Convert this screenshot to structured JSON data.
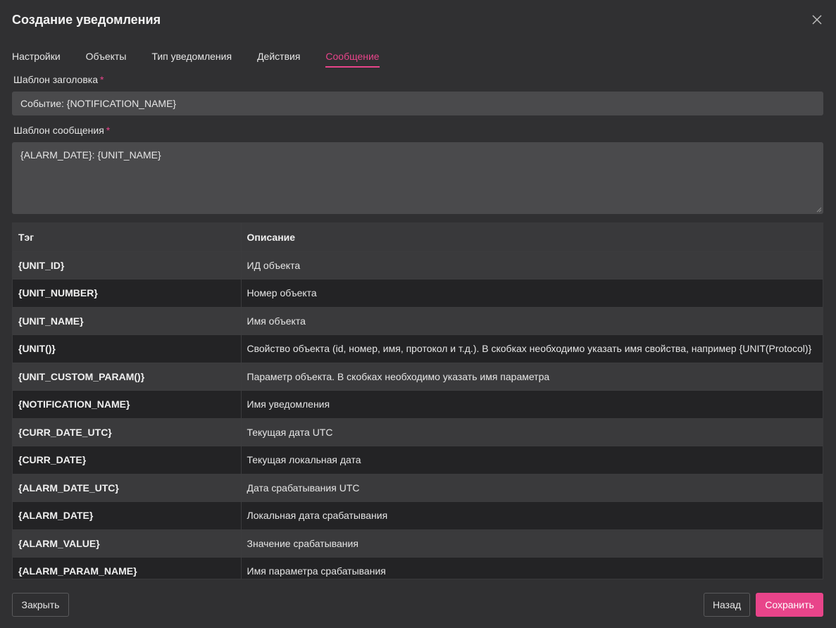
{
  "dialog": {
    "title": "Создание уведомления",
    "close_icon": "close-icon"
  },
  "tabs": [
    {
      "label": "Настройки",
      "active": false
    },
    {
      "label": "Объекты",
      "active": false
    },
    {
      "label": "Тип уведомления",
      "active": false
    },
    {
      "label": "Действия",
      "active": false
    },
    {
      "label": "Сообщение",
      "active": true
    }
  ],
  "form": {
    "header_template_label": "Шаблон заголовка",
    "header_template_value": "Событие: {NOTIFICATION_NAME}",
    "message_template_label": "Шаблон сообщения",
    "message_template_value": "{ALARM_DATE}: {UNIT_NAME}",
    "required_mark": "*"
  },
  "table": {
    "columns": [
      "Тэг",
      "Описание"
    ],
    "rows": [
      {
        "tag": "{UNIT_ID}",
        "desc": "ИД объекта"
      },
      {
        "tag": "{UNIT_NUMBER}",
        "desc": "Номер объекта"
      },
      {
        "tag": "{UNIT_NAME}",
        "desc": "Имя объекта"
      },
      {
        "tag": "{UNIT()}",
        "desc": "Свойство объекта (id, номер, имя, протокол и т.д.). В скобках необходимо указать имя свойства, например {UNIT(Protocol)}"
      },
      {
        "tag": "{UNIT_CUSTOM_PARAM()}",
        "desc": "Параметр объекта. В скобках необходимо указать имя параметра"
      },
      {
        "tag": "{NOTIFICATION_NAME}",
        "desc": "Имя уведомления"
      },
      {
        "tag": "{CURR_DATE_UTC}",
        "desc": "Текущая дата UTC"
      },
      {
        "tag": "{CURR_DATE}",
        "desc": "Текущая локальная дата"
      },
      {
        "tag": "{ALARM_DATE_UTC}",
        "desc": "Дата срабатывания UTC"
      },
      {
        "tag": "{ALARM_DATE}",
        "desc": "Локальная дата срабатывания"
      },
      {
        "tag": "{ALARM_VALUE}",
        "desc": "Значение срабатывания"
      },
      {
        "tag": "{ALARM_PARAM_NAME}",
        "desc": "Имя параметра срабатывания"
      }
    ]
  },
  "footer": {
    "close_label": "Закрыть",
    "back_label": "Назад",
    "save_label": "Сохранить"
  },
  "colors": {
    "accent": "#e8448a",
    "background": "#303032",
    "input_bg": "#4a4a4c"
  }
}
